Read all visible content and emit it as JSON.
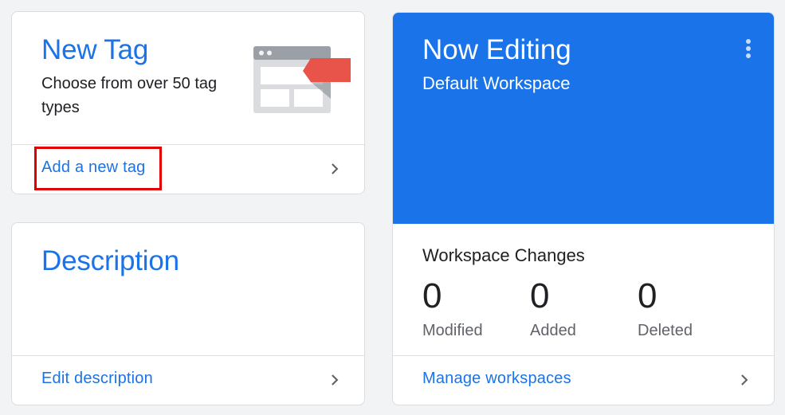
{
  "new_tag": {
    "title": "New Tag",
    "subtitle": "Choose from over 50 tag types",
    "link": "Add a new tag"
  },
  "description": {
    "title": "Description",
    "link": "Edit description"
  },
  "workspace": {
    "heading": "Now Editing",
    "name": "Default Workspace",
    "changes_heading": "Workspace Changes",
    "stats": [
      {
        "value": "0",
        "label": "Modified"
      },
      {
        "value": "0",
        "label": "Added"
      },
      {
        "value": "0",
        "label": "Deleted"
      }
    ],
    "link": "Manage workspaces"
  },
  "colors": {
    "accent": "#1a73e8",
    "highlight": "#e00000",
    "tag_red": "#e8534a"
  },
  "icons": [
    "tag-illustration-icon",
    "chevron-right-icon",
    "more-vert-icon"
  ]
}
